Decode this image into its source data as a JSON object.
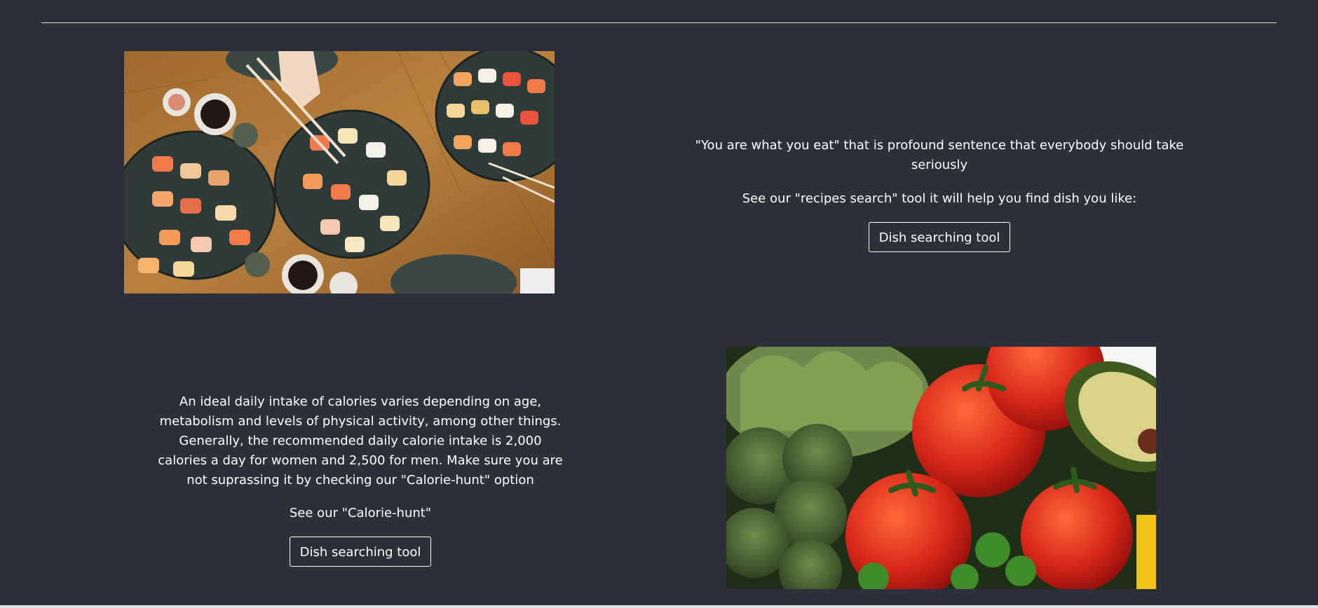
{
  "colors": {
    "background": "#2b303b",
    "text": "#ffffff",
    "rule": "#d9dde3"
  },
  "section_sushi": {
    "quote": "\"You are what you eat\" that is profound sentence that everybody should take seriously",
    "cta_text": "See our \"recipes search\" tool it will help you find dish you like:",
    "button_label": "Dish searching tool",
    "image_subject": "sushi-platters-photo"
  },
  "section_calories": {
    "paragraph": "An ideal daily intake of calories varies depending on age, metabolism and levels of physical activity, among other things. Generally, the recommended daily calorie intake is 2,000 calories a day for women and 2,500 for men. Make sure you are not suprassing it by checking our \"Calorie-hunt\" option",
    "cta_text": "See our \"Calorie-hunt\"",
    "button_label": "Dish searching tool",
    "image_subject": "tomatoes-broccoli-vegetables-photo"
  }
}
